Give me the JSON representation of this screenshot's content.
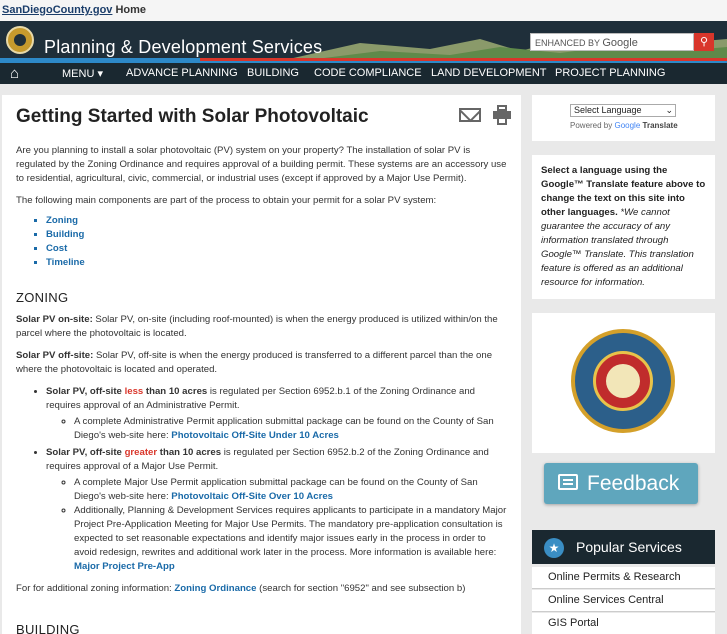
{
  "topbar": {
    "site_link": "SanDiegoCounty.gov",
    "home": "Home"
  },
  "header": {
    "title": "Planning & Development Services",
    "search_prefix": "ENHANCED BY",
    "search_brand": "Google"
  },
  "nav": {
    "items": [
      "MENU ▾",
      "ADVANCE PLANNING",
      "BUILDING",
      "CODE COMPLIANCE",
      "LAND DEVELOPMENT",
      "PROJECT PLANNING"
    ]
  },
  "main": {
    "title": "Getting Started with Solar Photovoltaic",
    "intro": "Are you planning to install a solar photovoltaic (PV) system on your property? The installation of solar PV is regulated by the Zoning Ordinance and requires approval of a building permit. These systems are an accessory use to residential, agricultural, civic, commercial, or industrial uses (except if approved by a Major Use Permit).",
    "components": "The following main components are part of the process to obtain your permit for a solar PV system:",
    "links": [
      "Zoning",
      "Building",
      "Cost",
      "Timeline"
    ],
    "zoning_heading": "ZONING",
    "onsite_label": "Solar PV on-site:",
    "onsite_text": " Solar PV, on-site (including roof-mounted) is when the energy produced is utilized within/on the parcel where the photovoltaic is located.",
    "offsite_label": "Solar PV off-site:",
    "offsite_text": " Solar PV, off-site is when the energy produced is transferred to a different parcel than the one where the photovoltaic is located and operated.",
    "less_pre": "Solar PV, off-site ",
    "less_word": "less",
    "less_post": " than 10 acres",
    "less_text": " is regulated per Section 6952.b.1 of the Zoning Ordinance and requires approval of an Administrative Permit.",
    "less_sub": "A complete Administrative Permit application submittal package can be found on the County of San Diego's web-site here: ",
    "less_link": "Photovoltaic Off-Site Under 10 Acres",
    "greater_pre": "Solar PV, off-site ",
    "greater_word": "greater",
    "greater_post": " than 10 acres",
    "greater_text": " is regulated per Section 6952.b.2 of the Zoning Ordinance and requires approval of a Major Use Permit.",
    "greater_sub1": "A complete Major Use Permit application submittal package can be found on the County of San Diego's web-site here: ",
    "greater_link": "Photovoltaic Off-Site Over 10 Acres",
    "greater_sub2": "Additionally, Planning & Development Services requires applicants to participate in a mandatory Major Project Pre-Application Meeting for Major Use Permits. The mandatory pre-application consultation is expected to set reasonable expectations and identify major issues early in the process in order to avoid redesign, rewrites and additional work later in the process.  More information is available here: ",
    "preapp_link": "Major Project Pre-App",
    "additional_pre": "For for additional zoning information: ",
    "additional_link": "Zoning Ordinance",
    "additional_post": " (search for section \"6952\" and see subsection b)",
    "building_heading": "BUILDING"
  },
  "sidebar": {
    "select_language": "Select Language",
    "powered_by": "Powered by",
    "google": "Google",
    "translate": "Translate",
    "note_bold": "Select a language using the Google™ Translate feature above to change the text on this site into other languages.",
    "note_italic": " *We cannot guarantee the accuracy of any information translated through Google™ Translate.  This translation feature is offered as an additional resource for information.",
    "feedback": "Feedback",
    "popular": "Popular Services",
    "services": [
      "Online Permits & Research",
      "Online Services Central",
      "GIS Portal"
    ]
  },
  "colors": {
    "nav_bg": "#1a2830",
    "link": "#1a6aa8",
    "accent_red": "#d9362b",
    "feedback": "#5fa6bd"
  }
}
